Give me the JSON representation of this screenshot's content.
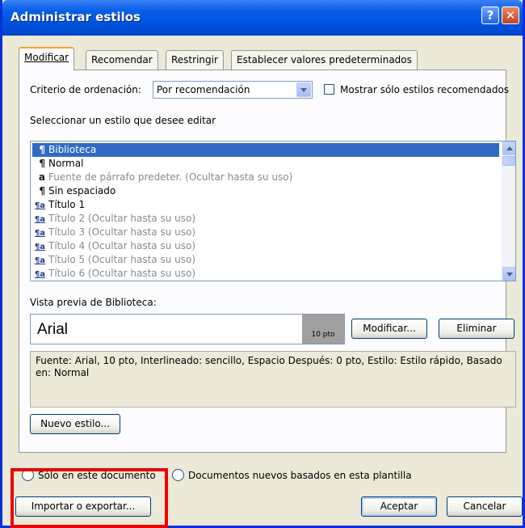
{
  "window": {
    "title": "Administrar estilos",
    "help_glyph": "?",
    "close_glyph": "✕"
  },
  "tabs": [
    {
      "label": "Modificar",
      "active": true
    },
    {
      "label": "Recomendar",
      "active": false
    },
    {
      "label": "Restringir",
      "active": false
    },
    {
      "label": "Establecer valores predeterminados",
      "active": false
    }
  ],
  "sort": {
    "label": "Criterio de ordenación:",
    "value": "Por recomendación"
  },
  "show_recommended": {
    "label": "Mostrar sólo estilos recomendados",
    "checked": false
  },
  "select_prompt": "Seleccionar un estilo que desee editar",
  "styles": [
    {
      "icon": "¶",
      "icon_name": "paragraph-style-icon",
      "name": "Biblioteca",
      "state": "selected"
    },
    {
      "icon": "¶",
      "icon_name": "paragraph-style-icon",
      "name": "Normal",
      "state": "normal"
    },
    {
      "icon": "a",
      "icon_name": "character-style-icon",
      "name": "Fuente de párrafo predeter.  (Ocultar hasta su uso)",
      "state": "hidden"
    },
    {
      "icon": "¶",
      "icon_name": "paragraph-style-icon",
      "name": "Sin espaciado",
      "state": "normal"
    },
    {
      "icon": "¶a",
      "icon_name": "linked-style-icon",
      "name": "Título 1",
      "state": "normal"
    },
    {
      "icon": "¶a",
      "icon_name": "linked-style-icon",
      "name": "Título 2  (Ocultar hasta su uso)",
      "state": "hidden"
    },
    {
      "icon": "¶a",
      "icon_name": "linked-style-icon",
      "name": "Título 3  (Ocultar hasta su uso)",
      "state": "hidden"
    },
    {
      "icon": "¶a",
      "icon_name": "linked-style-icon",
      "name": "Título 4  (Ocultar hasta su uso)",
      "state": "hidden"
    },
    {
      "icon": "¶a",
      "icon_name": "linked-style-icon",
      "name": "Título 5  (Ocultar hasta su uso)",
      "state": "hidden"
    },
    {
      "icon": "¶a",
      "icon_name": "linked-style-icon",
      "name": "Título 6  (Ocultar hasta su uso)",
      "state": "hidden"
    }
  ],
  "preview": {
    "label": "Vista previa de Biblioteca:",
    "font_name": "Arial",
    "size": "10 pto"
  },
  "buttons": {
    "modify": "Modificar...",
    "delete": "Eliminar",
    "new_style": "Nuevo estilo...",
    "import_export": "Importar o exportar...",
    "ok": "Aceptar",
    "cancel": "Cancelar"
  },
  "description": "Fuente: Arial, 10 pto, Interlineado:  sencillo, Espacio Después:  0 pto, Estilo: Estilo rápido, Basado en: Normal",
  "scope": {
    "this_document": "Sólo en este documento",
    "new_documents": "Documentos nuevos basados en esta plantilla",
    "selected": "none"
  },
  "colors": {
    "title_bar": "#0054e3",
    "selection": "#316ac5",
    "highlight_frame": "#ee0000",
    "dialog_bg": "#ece9d8"
  }
}
